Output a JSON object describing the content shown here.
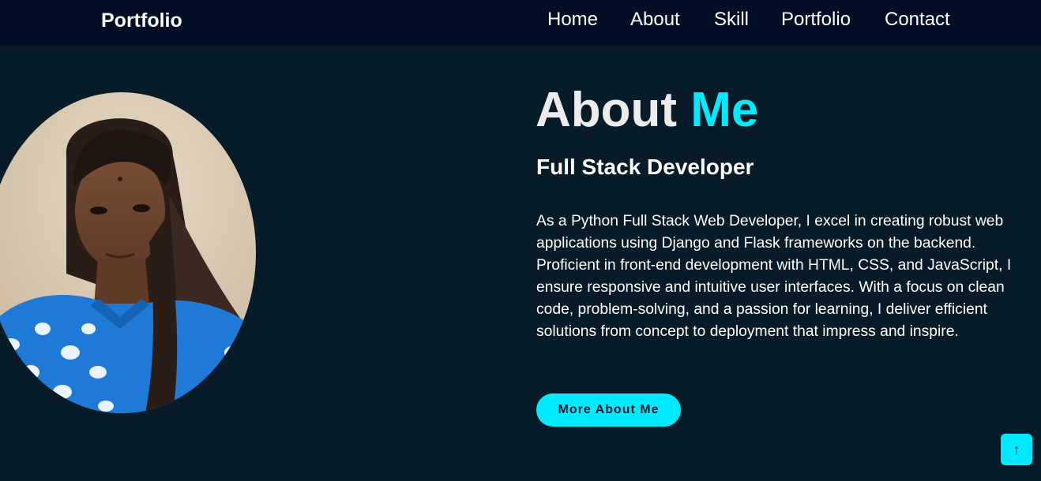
{
  "header": {
    "logo": "Portfolio",
    "nav": [
      {
        "label": "Home"
      },
      {
        "label": "About"
      },
      {
        "label": "Skill"
      },
      {
        "label": "Portfolio"
      },
      {
        "label": "Contact"
      }
    ]
  },
  "about": {
    "heading_main": "About",
    "heading_accent": "Me",
    "subtitle": "Full Stack Developer",
    "bio": "As a Python Full Stack Web Developer, I excel in creating robust web applications using Django and Flask frameworks on the backend. Proficient in front-end development with HTML, CSS, and JavaScript, I ensure responsive and intuitive user interfaces. With a focus on clean code, problem-solving, and a passion for learning, I deliver efficient solutions from concept to deployment that impress and inspire.",
    "button_label": "More About Me"
  },
  "scroll_top": {
    "icon": "arrow-up-icon",
    "glyph": "↑"
  },
  "colors": {
    "background": "#081b29",
    "navbar": "#020f27",
    "accent": "#00ebff",
    "text": "#ffffff"
  }
}
